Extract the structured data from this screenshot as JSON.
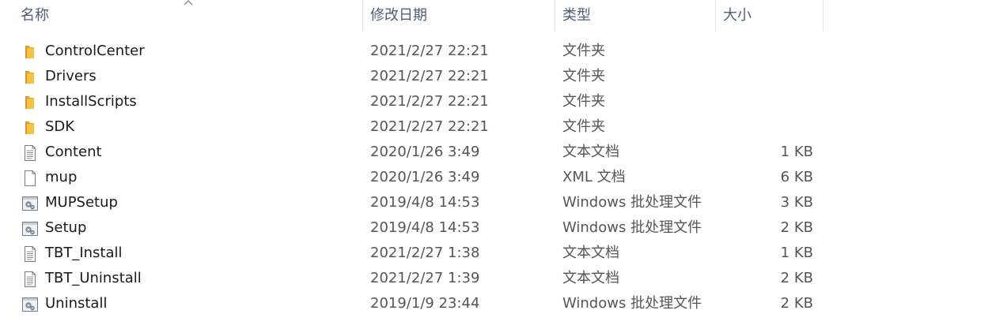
{
  "columns": {
    "name": "名称",
    "date": "修改日期",
    "type": "类型",
    "size": "大小"
  },
  "files": [
    {
      "name": "ControlCenter",
      "date": "2021/2/27 22:21",
      "type": "文件夹",
      "size": "",
      "icon": "folder-icon"
    },
    {
      "name": "Drivers",
      "date": "2021/2/27 22:21",
      "type": "文件夹",
      "size": "",
      "icon": "folder-icon"
    },
    {
      "name": "InstallScripts",
      "date": "2021/2/27 22:21",
      "type": "文件夹",
      "size": "",
      "icon": "folder-icon"
    },
    {
      "name": "SDK",
      "date": "2021/2/27 22:21",
      "type": "文件夹",
      "size": "",
      "icon": "folder-icon"
    },
    {
      "name": "Content",
      "date": "2020/1/26 3:49",
      "type": "文本文档",
      "size": "1 KB",
      "icon": "text-file-icon"
    },
    {
      "name": "mup",
      "date": "2020/1/26 3:49",
      "type": "XML 文档",
      "size": "6 KB",
      "icon": "xml-file-icon"
    },
    {
      "name": "MUPSetup",
      "date": "2019/4/8 14:53",
      "type": "Windows 批处理文件",
      "size": "3 KB",
      "icon": "batch-file-icon"
    },
    {
      "name": "Setup",
      "date": "2019/4/8 14:53",
      "type": "Windows 批处理文件",
      "size": "2 KB",
      "icon": "batch-file-icon"
    },
    {
      "name": "TBT_Install",
      "date": "2021/2/27 1:38",
      "type": "文本文档",
      "size": "1 KB",
      "icon": "text-file-icon"
    },
    {
      "name": "TBT_Uninstall",
      "date": "2021/2/27 1:39",
      "type": "文本文档",
      "size": "2 KB",
      "icon": "text-file-icon"
    },
    {
      "name": "Uninstall",
      "date": "2019/1/9 23:44",
      "type": "Windows 批处理文件",
      "size": "2 KB",
      "icon": "batch-file-icon"
    }
  ],
  "colors": {
    "header_text": "#4c607a",
    "folder_yellow": "#f5c342",
    "detail_text": "#555555"
  }
}
